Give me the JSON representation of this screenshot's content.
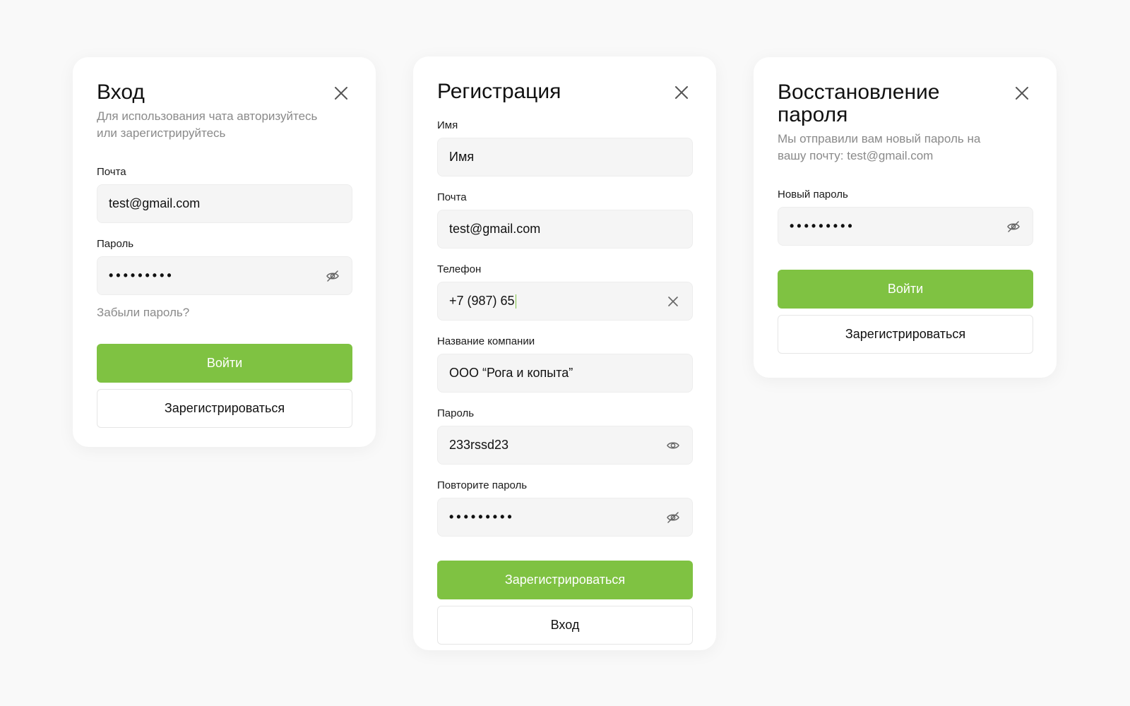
{
  "colors": {
    "background": "#f9f9f9",
    "card": "#ffffff",
    "accent": "#7fc242",
    "muted_text": "#8a8a8a",
    "input_bg": "#f5f5f5"
  },
  "login": {
    "title": "Вход",
    "subtitle": "Для использования чата авторизуйтесь или зарегистрируйтесь",
    "close_icon": "close-icon",
    "email": {
      "label": "Почта",
      "value": "test@gmail.com"
    },
    "password": {
      "label": "Пароль",
      "value": "•••••••••",
      "icon": "eye-off-icon"
    },
    "forgot_link": "Забыли пароль?",
    "primary_button": "Войти",
    "secondary_button": "Зарегистрироваться"
  },
  "register": {
    "title": "Регистрация",
    "close_icon": "close-icon",
    "name": {
      "label": "Имя",
      "value": "Имя"
    },
    "email": {
      "label": "Почта",
      "value": "test@gmail.com"
    },
    "phone": {
      "label": "Телефон",
      "value": "+7 (987) 65",
      "icon": "clear-icon"
    },
    "company": {
      "label": "Название компании",
      "value": "ООО “Рога и копыта”"
    },
    "password": {
      "label": "Пароль",
      "value": "233rssd23",
      "icon": "eye-icon"
    },
    "repeat_password": {
      "label": "Повторите пароль",
      "value": "•••••••••",
      "icon": "eye-off-icon"
    },
    "primary_button": "Зарегистрироваться",
    "secondary_button": "Вход"
  },
  "recovery": {
    "title": "Восстановление пароля",
    "subtitle": "Мы отправили вам новый пароль на вашу почту: test@gmail.com",
    "close_icon": "close-icon",
    "new_password": {
      "label": "Новый пароль",
      "value": "•••••••••",
      "icon": "eye-off-icon"
    },
    "primary_button": "Войти",
    "secondary_button": "Зарегистрироваться"
  }
}
